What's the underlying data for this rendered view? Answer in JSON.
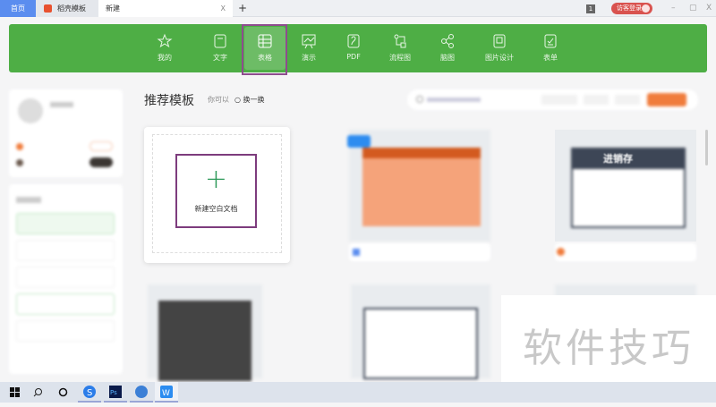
{
  "tabs": {
    "home": "首页",
    "daoke": "稻壳模板",
    "new": "新建",
    "close": "X",
    "add": "+"
  },
  "titlebar": {
    "count": "1",
    "login": "访客登录",
    "minimize": "–",
    "restore": "▢",
    "close": "X"
  },
  "nav": [
    {
      "label": "我的"
    },
    {
      "label": "文字"
    },
    {
      "label": "表格"
    },
    {
      "label": "演示"
    },
    {
      "label": "PDF"
    },
    {
      "label": "流程图"
    },
    {
      "label": "脑图"
    },
    {
      "label": "图片设计"
    },
    {
      "label": "表单"
    }
  ],
  "main": {
    "title": "推荐模板",
    "subtitle": "你可以",
    "swap": "换一换",
    "new_blank": "新建空白文档",
    "plus": "+",
    "template_badge_text": "进销存"
  },
  "watermark": "软件技巧",
  "colors": {
    "accent": "#4eae45",
    "highlight": "#8e4d8e",
    "orange": "#f07c3c"
  }
}
